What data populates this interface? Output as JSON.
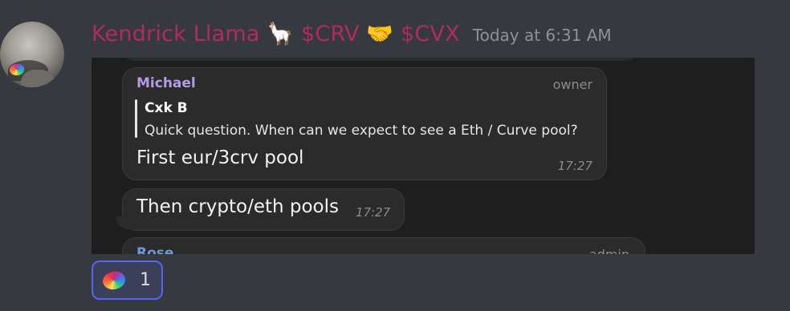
{
  "message": {
    "username": "Kendrick Llama 🦙 $CRV 🤝 $CVX",
    "timestamp": "Today at 6:31 AM",
    "avatar_icon": "user-avatar"
  },
  "embed": {
    "bubbles": [
      {
        "sender": "Michael",
        "role": "owner",
        "reply_to": {
          "name": "Cxk B",
          "text": "Quick question. When can we expect to see a Eth / Curve pool?"
        },
        "text": "First eur/3crv pool",
        "time": "17:27"
      },
      {
        "text": "Then crypto/eth pools",
        "time": "17:27"
      },
      {
        "sender": "Rose",
        "role": "admin"
      }
    ]
  },
  "reaction": {
    "emoji": "curve-logo-icon",
    "count": "1"
  },
  "colors": {
    "background": "#36393f",
    "username": "#b02b61",
    "timestamp": "#8e9297",
    "embed_bg": "#1e1e1e",
    "bubble_bg": "#2b2b2b",
    "michael_name": "#b49be6",
    "rose_name": "#6c99d6",
    "reaction_border": "#5865f2"
  }
}
